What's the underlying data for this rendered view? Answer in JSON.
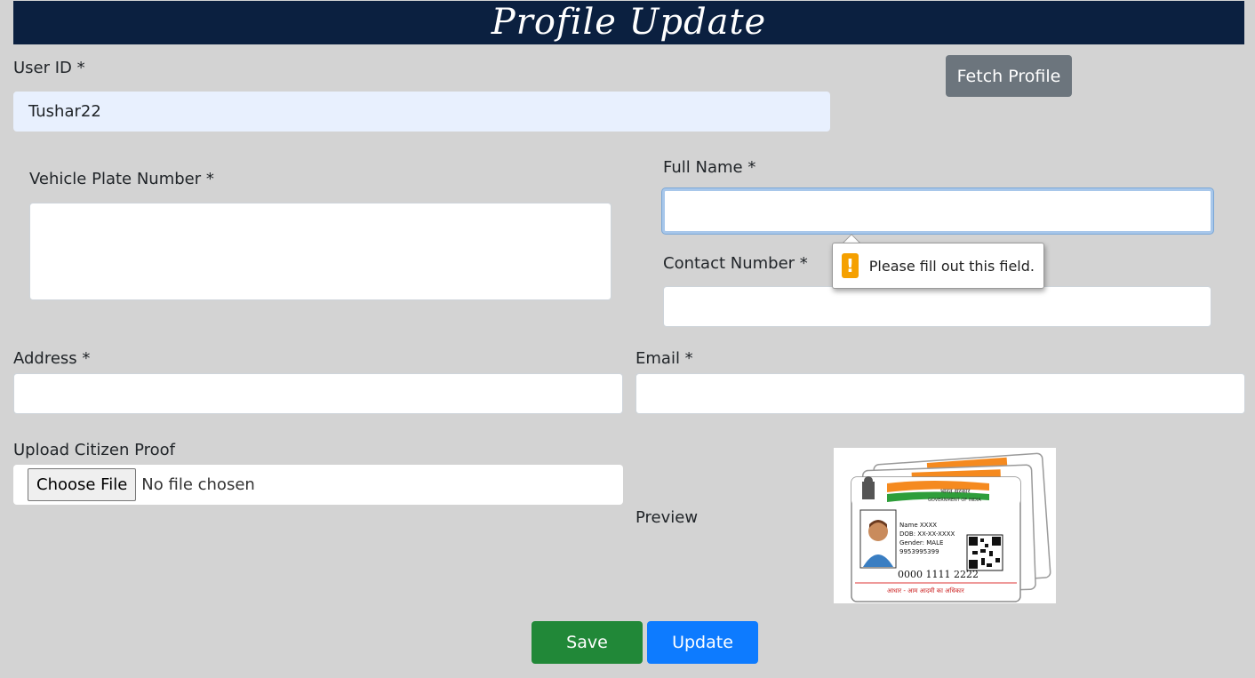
{
  "header": {
    "title": "Profile Update"
  },
  "form": {
    "user_id": {
      "label": "User ID *",
      "value": "Tushar22"
    },
    "fetch_button": "Fetch Profile",
    "vehicle_plate": {
      "label": "Vehicle Plate Number *",
      "value": ""
    },
    "full_name": {
      "label": "Full Name *",
      "value": ""
    },
    "contact_number": {
      "label": "Contact Number *",
      "value": ""
    },
    "address": {
      "label": "Address *",
      "value": ""
    },
    "email": {
      "label": "Email *",
      "value": ""
    },
    "citizen_proof": {
      "label": "Upload Citizen Proof",
      "choose_label": "Choose File",
      "status": "No file chosen"
    },
    "preview": {
      "label": "Preview",
      "card": {
        "header_hindi": "भारत सरकार",
        "header_english": "GOVERNMENT OF INDIA",
        "name": "Name XXXX",
        "dob": "DOB: XX-XX-XXXX",
        "gender": "Gender: MALE",
        "phone": "9953995399",
        "number": "0000 1111 2222",
        "footer": "आधार - आम आदमी का अधिकार"
      }
    },
    "save_button": "Save",
    "update_button": "Update"
  },
  "validation": {
    "message": "Please fill out this field.",
    "icon": "warning-icon"
  },
  "colors": {
    "page_bg": "#d3d3d3",
    "banner_bg": "#0b2040",
    "fetch_btn": "#6c757d",
    "save_btn": "#218838",
    "update_btn": "#0d7bff",
    "warning": "#f5a000",
    "autofill_bg": "#e8f0fe"
  }
}
